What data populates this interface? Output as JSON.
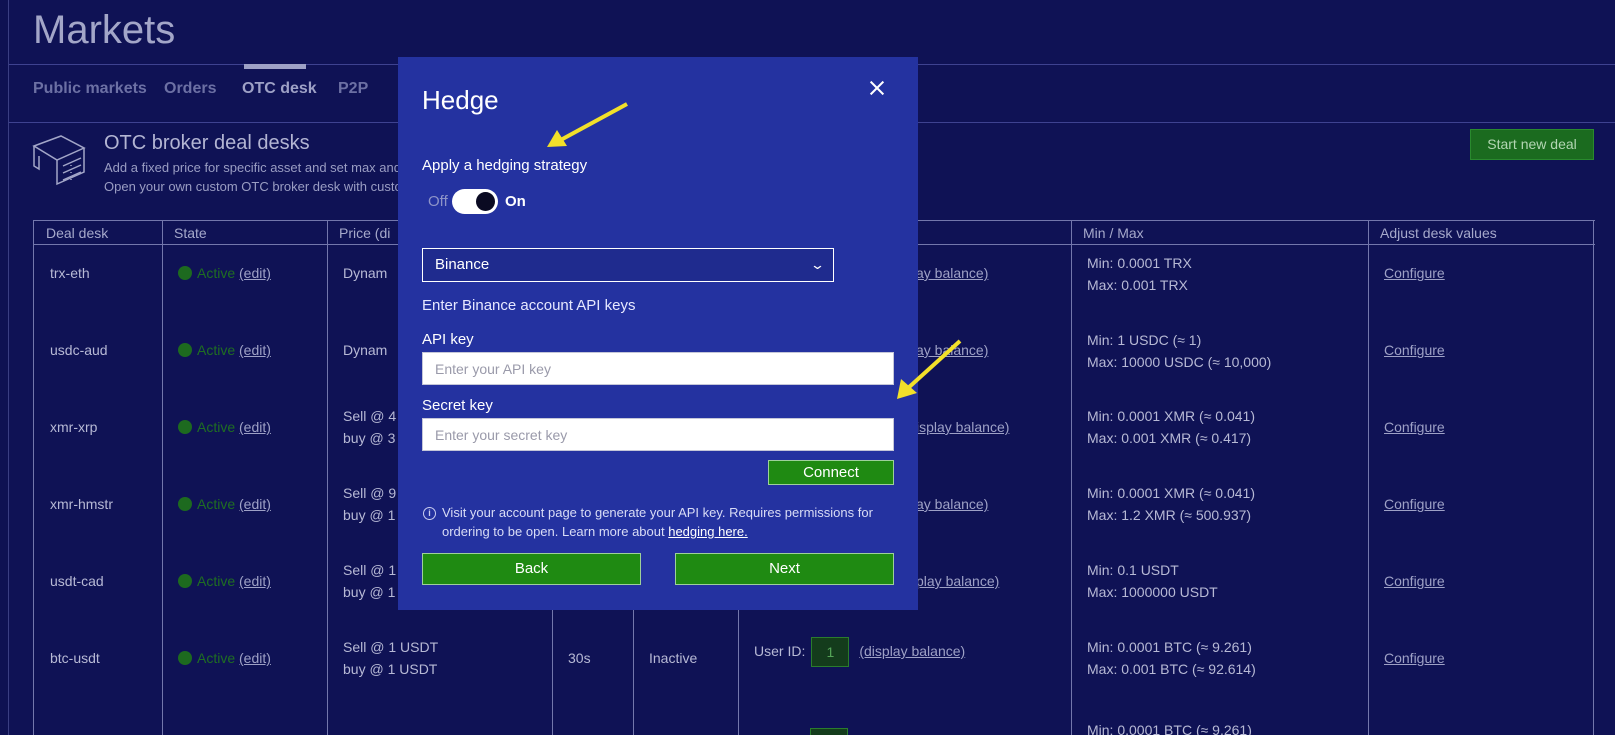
{
  "page": {
    "title": "Markets"
  },
  "tabs": [
    {
      "label": "Public markets"
    },
    {
      "label": "Orders"
    },
    {
      "label": "OTC desk"
    },
    {
      "label": "P2P"
    }
  ],
  "otc": {
    "title": "OTC broker deal desks",
    "desc_line1": "Add a fixed price for specific asset and set max and m",
    "desc_line2": "Open your own custom OTC broker desk with custon",
    "start_button": "Start new deal"
  },
  "table": {
    "headers": {
      "deal_desk": "Deal desk",
      "state": "State",
      "price": "Price (di",
      "min_max": "Min / Max",
      "adjust": "Adjust desk values"
    },
    "rows": [
      {
        "desk": "trx-eth",
        "state": "Active",
        "edit": "(edit)",
        "price1": "Dynam",
        "price2": "",
        "timer": "",
        "status": "",
        "uid_label": "",
        "uid": "",
        "balance": "ay balance)",
        "min": "Min: 0.0001 TRX",
        "max": "Max: 0.001 TRX",
        "configure": "Configure"
      },
      {
        "desk": "usdc-aud",
        "state": "Active",
        "edit": "(edit)",
        "price1": "Dynam",
        "price2": "",
        "timer": "",
        "status": "",
        "uid_label": "",
        "uid": "",
        "balance": "ay balance)",
        "min": "Min: 1 USDC (≈ 1)",
        "max": "Max: 10000 USDC (≈ 10,000)",
        "configure": "Configure"
      },
      {
        "desk": "xmr-xrp",
        "state": "Active",
        "edit": "(edit)",
        "price1": "Sell @ 4",
        "price2": "buy @ 3",
        "timer": "",
        "status": "",
        "uid_label": "",
        "uid": "",
        "balance": "isplay balance)",
        "min": "Min: 0.0001 XMR (≈ 0.041)",
        "max": "Max: 0.001 XMR (≈ 0.417)",
        "configure": "Configure"
      },
      {
        "desk": "xmr-hmstr",
        "state": "Active",
        "edit": "(edit)",
        "price1": "Sell @ 9",
        "price2": "buy @ 1",
        "timer": "",
        "status": "",
        "uid_label": "",
        "uid": "",
        "balance": "ay balance)",
        "min": "Min: 0.0001 XMR (≈ 0.041)",
        "max": "Max: 1.2 XMR (≈ 500.937)",
        "configure": "Configure"
      },
      {
        "desk": "usdt-cad",
        "state": "Active",
        "edit": "(edit)",
        "price1": "Sell @ 1",
        "price2": "buy @ 1",
        "timer": "",
        "status": "",
        "uid_label": "",
        "uid": "",
        "balance": "play balance)",
        "min": "Min: 0.1 USDT",
        "max": "Max: 1000000 USDT",
        "configure": "Configure"
      },
      {
        "desk": "btc-usdt",
        "state": "Active",
        "edit": "(edit)",
        "price1": "Sell @ 1 USDT",
        "price2": "buy @ 1 USDT",
        "timer": "30s",
        "status": "Inactive",
        "uid_label": "User ID:",
        "uid": "1",
        "balance": "(display balance)",
        "min": "Min: 0.0001 BTC (≈ 9.261)",
        "max": "Max: 0.001 BTC (≈ 92.614)",
        "configure": "Configure"
      }
    ],
    "partial_min": "Min: 0.0001 BTC (≈ 9.261)"
  },
  "modal": {
    "title": "Hedge",
    "strategy_label": "Apply a hedging strategy",
    "toggle_off": "Off",
    "toggle_on": "On",
    "toggle_state": "on",
    "exchange": "Binance",
    "keys_heading": "Enter Binance account API keys",
    "api_key_label": "API key",
    "api_key_placeholder": "Enter your API key",
    "secret_key_label": "Secret key",
    "secret_key_placeholder": "Enter your secret key",
    "connect_button": "Connect",
    "info_text": "Visit your account page to generate your API key. Requires permissions for ordering to be open. Learn more about ",
    "info_link": "hedging here.",
    "back_button": "Back",
    "next_button": "Next"
  },
  "colors": {
    "background": "#0f1255",
    "modal": "#2432a0",
    "button_green": "#1f8a12",
    "annotation_arrow": "#f2e02a"
  },
  "icons": [
    "desk-icon",
    "close-icon",
    "chevron-down-icon",
    "info-icon",
    "status-dot-icon"
  ]
}
